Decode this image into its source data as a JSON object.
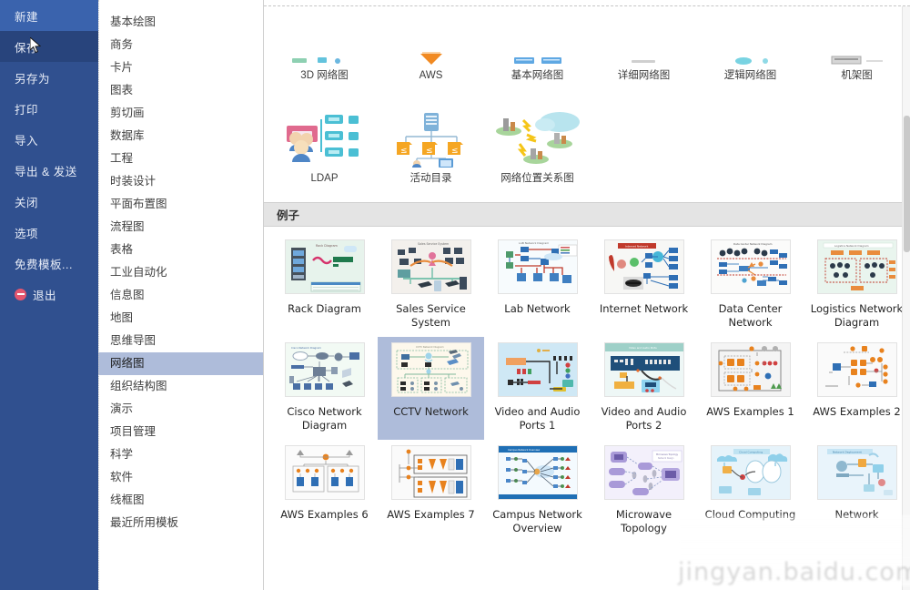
{
  "sidebar": {
    "items": [
      {
        "label": "新建",
        "state": "highlighted",
        "icon": ""
      },
      {
        "label": "保存",
        "state": "hover",
        "icon": ""
      },
      {
        "label": "另存为",
        "state": "normal",
        "icon": ""
      },
      {
        "label": "打印",
        "state": "normal",
        "icon": ""
      },
      {
        "label": "导入",
        "state": "normal",
        "icon": ""
      },
      {
        "label": "导出 & 发送",
        "state": "normal",
        "icon": ""
      },
      {
        "label": "关闭",
        "state": "normal",
        "icon": ""
      },
      {
        "label": "选项",
        "state": "normal",
        "icon": ""
      },
      {
        "label": "免费模板...",
        "state": "normal",
        "icon": ""
      },
      {
        "label": "退出",
        "state": "normal",
        "icon": "no-entry-icon"
      }
    ],
    "background_color": "#30508f",
    "highlight_color": "#3a63ad",
    "hover_color": "#28447c"
  },
  "categories": {
    "selected": "网络图",
    "highlight_color": "#aebcda",
    "items": [
      "基本绘图",
      "商务",
      "卡片",
      "图表",
      "剪切画",
      "数据库",
      "工程",
      "时装设计",
      "平面布置图",
      "流程图",
      "表格",
      "工业自动化",
      "信息图",
      "地图",
      "思维导图",
      "网络图",
      "组织结构图",
      "演示",
      "项目管理",
      "科学",
      "软件",
      "线框图",
      "最近所用模板"
    ]
  },
  "templates": {
    "row_top": [
      {
        "label": "3D 网络图"
      },
      {
        "label": "AWS"
      },
      {
        "label": "基本网络图"
      },
      {
        "label": "详细网络图"
      },
      {
        "label": "逻辑网络图"
      },
      {
        "label": "机架图"
      }
    ],
    "row_second": [
      {
        "label": "LDAP"
      },
      {
        "label": "活动目录"
      },
      {
        "label": "网络位置关系图"
      }
    ]
  },
  "examples": {
    "section_title": "例子",
    "selected": "CCTV Network",
    "selection_color": "#aebcda",
    "items": [
      {
        "label": "Rack Diagram",
        "selected": false
      },
      {
        "label": "Sales Service System",
        "selected": false
      },
      {
        "label": "Lab Network",
        "selected": false
      },
      {
        "label": "Internet Network",
        "selected": false
      },
      {
        "label": "Data Center Network",
        "selected": false
      },
      {
        "label": "Logistics Network Diagram",
        "selected": false
      },
      {
        "label": "Cisco Network Diagram",
        "selected": false
      },
      {
        "label": "CCTV Network",
        "selected": true
      },
      {
        "label": "Video and Audio Ports 1",
        "selected": false
      },
      {
        "label": "Video and Audio Ports 2",
        "selected": false
      },
      {
        "label": "AWS Examples 1",
        "selected": false
      },
      {
        "label": "AWS Examples 2",
        "selected": false
      },
      {
        "label": "AWS Examples 6",
        "selected": false
      },
      {
        "label": "AWS Examples 7",
        "selected": false
      },
      {
        "label": "Campus Network Overview",
        "selected": false
      },
      {
        "label": "Microwave Topology",
        "selected": false
      },
      {
        "label": "Cloud Computing",
        "selected": false
      },
      {
        "label": "Network",
        "selected": false
      }
    ]
  },
  "watermark": {
    "text": "jingyan.baidu.com"
  }
}
